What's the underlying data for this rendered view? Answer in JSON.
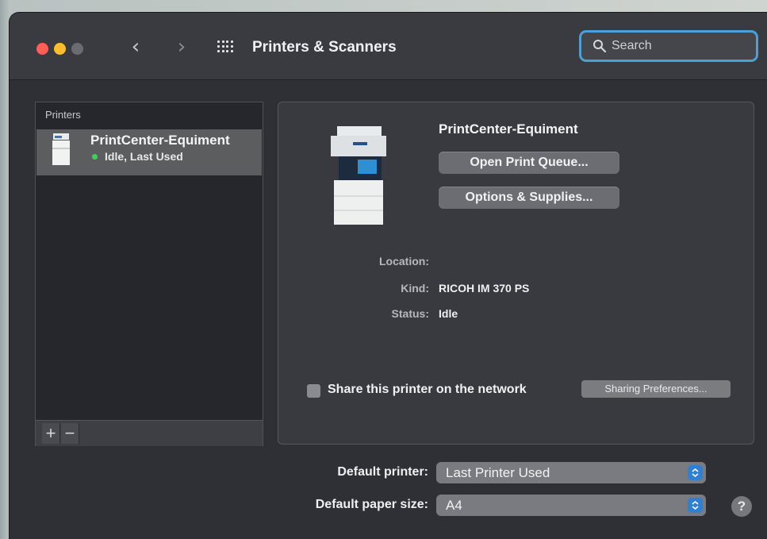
{
  "window": {
    "title": "Printers & Scanners"
  },
  "search": {
    "placeholder": "Search"
  },
  "sidebar": {
    "header": "Printers",
    "printers": [
      {
        "name": "PrintCenter-Equiment",
        "status": "Idle, Last Used",
        "status_color": "#3bd15a"
      }
    ],
    "add_label": "+",
    "remove_label": "−"
  },
  "detail": {
    "printer_name": "PrintCenter-Equiment",
    "open_queue_label": "Open Print Queue...",
    "options_label": "Options & Supplies...",
    "location_label": "Location:",
    "location_value": "",
    "kind_label": "Kind:",
    "kind_value": "RICOH IM 370 PS",
    "status_label": "Status:",
    "status_value": "Idle",
    "share_label": "Share this printer on the network",
    "share_checked": false,
    "sharing_prefs_label": "Sharing Preferences..."
  },
  "defaults": {
    "printer_label": "Default printer:",
    "printer_value": "Last Printer Used",
    "paper_label": "Default paper size:",
    "paper_value": "A4"
  },
  "help_label": "?",
  "colors": {
    "accent": "#2f7fd3",
    "close": "#ff5f57",
    "minimize": "#febc2e",
    "window_bg": "#2f3036"
  }
}
